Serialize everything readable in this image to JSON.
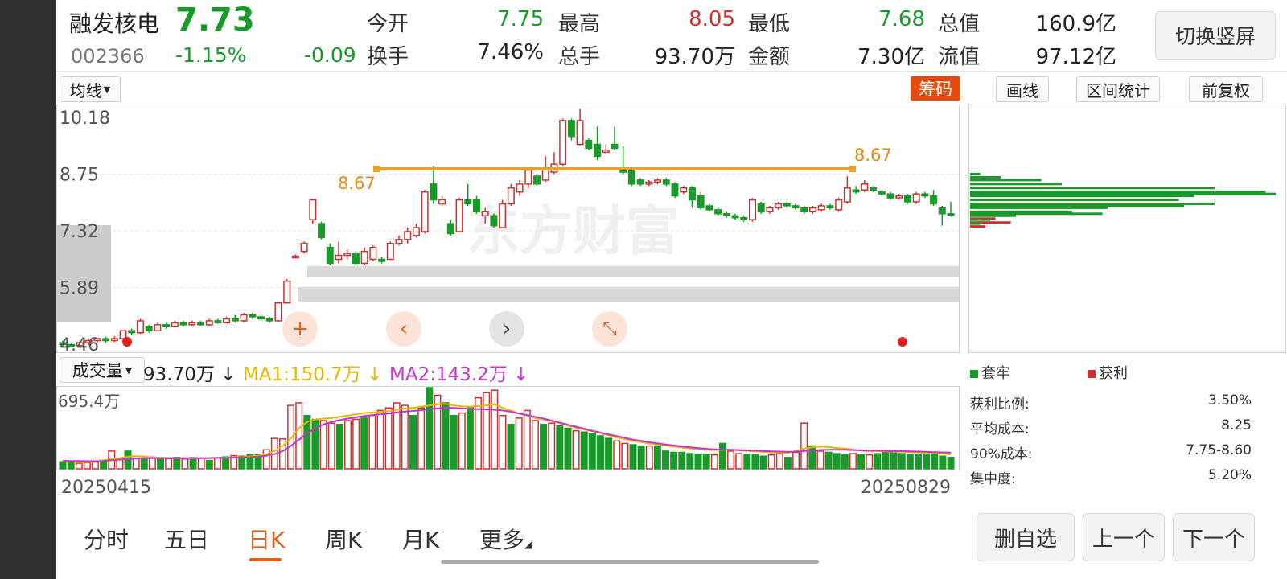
{
  "stock": {
    "name": "融发核电",
    "price": "7.73",
    "code": "002366",
    "change_pct": "-1.15%",
    "change": "-0.09"
  },
  "quote": {
    "open_label": "今开",
    "open": "7.75",
    "high_label": "最高",
    "high": "8.05",
    "low_label": "最低",
    "low": "7.68",
    "mktcap_label": "总值",
    "mktcap": "160.9亿",
    "turnover_label": "换手",
    "turnover": "7.46%",
    "vol_label": "总手",
    "vol": "93.70万",
    "amount_label": "金额",
    "amount": "7.30亿",
    "float_label": "流值",
    "float": "97.12亿"
  },
  "switch_button": "切换竖屏",
  "toolbar": {
    "ma_select": "均线",
    "chip_label": "筹码",
    "draw_label": "画线",
    "range_stats_label": "区间统计",
    "adjust_label": "前复权"
  },
  "price_axis": [
    "10.18",
    "8.75",
    "7.32",
    "5.89",
    "4.46"
  ],
  "cost_level_label": "8.67",
  "watermark": "东方财富",
  "volume": {
    "select_label": "成交量",
    "value": "93.70万",
    "ma1": "MA1:150.7万",
    "ma2": "MA2:143.2万",
    "axis_max": "695.4万"
  },
  "dates": {
    "start": "20250415",
    "end": "20250829"
  },
  "chip": {
    "legend_loss": "套牢",
    "legend_profit": "获利",
    "stats": [
      {
        "label": "获利比例:",
        "value": "3.50%"
      },
      {
        "label": "平均成本:",
        "value": "8.25"
      },
      {
        "label": "90%成本:",
        "value": "7.75-8.60"
      },
      {
        "label": "集中度:",
        "value": "5.20%"
      }
    ]
  },
  "tabs": [
    "分时",
    "五日",
    "日K",
    "周K",
    "月K",
    "更多"
  ],
  "active_tab": "日K",
  "bottom_buttons": {
    "remove": "删自选",
    "prev": "上一个",
    "next": "下一个"
  },
  "colors": {
    "up": "#d23030",
    "down": "#1a9a2a",
    "cost_line": "#f0a020",
    "ma1": "#e6b800",
    "ma2": "#cc33cc",
    "chip_button": "#e34b0e"
  },
  "chart_data": {
    "type": "candlestick",
    "y_axis": [
      4.46,
      10.18
    ],
    "candles": [
      [
        4.5,
        4.45,
        4.55,
        4.4
      ],
      [
        4.45,
        4.42,
        4.5,
        4.38
      ],
      [
        4.42,
        4.5,
        4.55,
        4.4
      ],
      [
        4.5,
        4.55,
        4.6,
        4.45
      ],
      [
        4.55,
        4.6,
        4.62,
        4.5
      ],
      [
        4.6,
        4.55,
        4.65,
        4.5
      ],
      [
        4.55,
        4.6,
        4.66,
        4.52
      ],
      [
        4.6,
        4.8,
        4.82,
        4.58
      ],
      [
        4.8,
        4.75,
        4.85,
        4.7
      ],
      [
        4.75,
        5.05,
        5.1,
        4.72
      ],
      [
        4.9,
        4.8,
        4.95,
        4.75
      ],
      [
        4.8,
        4.95,
        5,
        4.78
      ],
      [
        4.95,
        4.9,
        5,
        4.85
      ],
      [
        4.9,
        5,
        5.05,
        4.88
      ],
      [
        5,
        4.95,
        5.05,
        4.9
      ],
      [
        4.95,
        5,
        5.05,
        4.9
      ],
      [
        5,
        4.95,
        5.05,
        4.92
      ],
      [
        4.95,
        5.05,
        5.1,
        4.92
      ],
      [
        5.05,
        5,
        5.1,
        4.98
      ],
      [
        5,
        5.1,
        5.15,
        4.98
      ],
      [
        5.1,
        5.05,
        5.2,
        5
      ],
      [
        5.05,
        5.2,
        5.25,
        5.02
      ],
      [
        5.2,
        5.15,
        5.25,
        5.1
      ],
      [
        5.15,
        5.1,
        5.2,
        5.05
      ],
      [
        5.1,
        5.05,
        5.15,
        5
      ],
      [
        5.05,
        5.5,
        5.52,
        5.05
      ],
      [
        5.5,
        6.05,
        6.1,
        5.5
      ],
      [
        6.66,
        6.68,
        6.72,
        6.62
      ],
      [
        6.8,
        7.0,
        7.05,
        6.75
      ],
      [
        7.6,
        8.1,
        8.12,
        7.5
      ],
      [
        7.5,
        7.15,
        7.55,
        7.1
      ],
      [
        6.9,
        6.5,
        7.0,
        6.45
      ],
      [
        6.6,
        6.7,
        7.05,
        6.5
      ],
      [
        6.7,
        6.75,
        6.85,
        6.6
      ],
      [
        6.75,
        6.5,
        6.8,
        6.4
      ],
      [
        6.5,
        6.8,
        6.9,
        6.45
      ],
      [
        6.6,
        6.9,
        6.95,
        6.55
      ],
      [
        6.6,
        6.55,
        6.65,
        6.5
      ],
      [
        6.6,
        7.0,
        7.05,
        6.58
      ],
      [
        7.0,
        7.1,
        7.2,
        6.95
      ],
      [
        7.1,
        7.3,
        7.4,
        7.0
      ],
      [
        7.2,
        7.4,
        7.5,
        7.15
      ],
      [
        7.3,
        8.3,
        8.35,
        7.25
      ],
      [
        8.5,
        8.1,
        8.95,
        8.0
      ],
      [
        8.0,
        8.1,
        8.2,
        7.95
      ],
      [
        7.5,
        7.25,
        7.6,
        7.2
      ],
      [
        7.3,
        8.1,
        8.15,
        7.28
      ],
      [
        8.1,
        8.0,
        8.5,
        7.95
      ],
      [
        8.1,
        7.8,
        8.2,
        7.75
      ],
      [
        7.7,
        7.8,
        7.9,
        7.5
      ],
      [
        7.7,
        7.45,
        7.75,
        7.4
      ],
      [
        7.4,
        8.0,
        8.1,
        7.38
      ],
      [
        8.0,
        8.4,
        8.5,
        7.95
      ],
      [
        8.3,
        8.5,
        8.6,
        8.2
      ],
      [
        8.5,
        8.85,
        8.9,
        8.4
      ],
      [
        8.7,
        8.5,
        8.75,
        8.45
      ],
      [
        8.6,
        8.9,
        9.2,
        8.55
      ],
      [
        8.8,
        9.0,
        9.3,
        8.75
      ],
      [
        9.0,
        10.1,
        10.15,
        8.95
      ],
      [
        10.1,
        9.7,
        10.15,
        9.6
      ],
      [
        9.5,
        10.1,
        10.4,
        9.45
      ],
      [
        9.6,
        9.4,
        9.65,
        9.35
      ],
      [
        9.5,
        9.2,
        9.95,
        9.1
      ],
      [
        9.3,
        9.35,
        9.5,
        9.25
      ],
      [
        9.5,
        9.4,
        9.95,
        9.35
      ],
      [
        8.9,
        8.8,
        9.45,
        8.75
      ],
      [
        8.85,
        8.5,
        8.9,
        8.45
      ],
      [
        8.6,
        8.5,
        8.65,
        8.45
      ],
      [
        8.5,
        8.55,
        8.6,
        8.45
      ],
      [
        8.55,
        8.6,
        8.65,
        8.5
      ],
      [
        8.6,
        8.5,
        8.65,
        8.45
      ],
      [
        8.5,
        8.2,
        8.55,
        8.15
      ],
      [
        8.3,
        8.4,
        8.45,
        8.25
      ],
      [
        8.4,
        8.1,
        8.45,
        7.9
      ],
      [
        8.2,
        7.9,
        8.3,
        7.85
      ],
      [
        7.95,
        7.85,
        8.0,
        7.8
      ],
      [
        7.85,
        7.75,
        7.9,
        7.7
      ],
      [
        7.75,
        7.7,
        7.8,
        7.65
      ],
      [
        7.7,
        7.65,
        7.75,
        7.6
      ],
      [
        7.65,
        7.6,
        7.7,
        7.55
      ],
      [
        7.6,
        8.1,
        8.15,
        7.55
      ],
      [
        8.0,
        7.8,
        8.05,
        7.75
      ],
      [
        7.8,
        7.9,
        7.95,
        7.75
      ],
      [
        7.9,
        8.0,
        8.05,
        7.85
      ],
      [
        8.0,
        7.95,
        8.05,
        7.9
      ],
      [
        7.95,
        7.9,
        8.0,
        7.85
      ],
      [
        7.9,
        7.8,
        7.95,
        7.75
      ],
      [
        7.8,
        7.9,
        7.95,
        7.75
      ],
      [
        7.85,
        7.95,
        8.0,
        7.8
      ],
      [
        7.95,
        7.9,
        8.0,
        7.85
      ],
      [
        7.85,
        8.1,
        8.15,
        7.8
      ],
      [
        8.05,
        8.4,
        8.7,
        8.0
      ],
      [
        8.35,
        8.3,
        8.45,
        8.25
      ],
      [
        8.35,
        8.5,
        8.6,
        8.3
      ],
      [
        8.4,
        8.35,
        8.45,
        8.3
      ],
      [
        8.3,
        8.25,
        8.35,
        8.2
      ],
      [
        8.25,
        8.15,
        8.3,
        8.1
      ],
      [
        8.15,
        8.2,
        8.25,
        8.1
      ],
      [
        8.2,
        8.05,
        8.25,
        8.0
      ],
      [
        8.05,
        8.25,
        8.3,
        8.0
      ],
      [
        8.25,
        8.2,
        8.3,
        8.15
      ],
      [
        8.2,
        8.0,
        8.35,
        7.95
      ],
      [
        7.9,
        7.75,
        7.95,
        7.45
      ],
      [
        7.75,
        7.73,
        8.05,
        7.68
      ]
    ],
    "volume": [
      28,
      26,
      22,
      25,
      27,
      34,
      70,
      38,
      70,
      41,
      43,
      46,
      37,
      40,
      45,
      39,
      44,
      43,
      33,
      44,
      47,
      52,
      50,
      57,
      55,
      75,
      120,
      118,
      250,
      260,
      210,
      195,
      190,
      180,
      175,
      190,
      195,
      200,
      210,
      230,
      240,
      260,
      250,
      210,
      240,
      320,
      290,
      260,
      210,
      220,
      240,
      280,
      300,
      310,
      210,
      175,
      200,
      230,
      190,
      175,
      180,
      170,
      160,
      150,
      145,
      140,
      130,
      120,
      110,
      100,
      95,
      90,
      90,
      90,
      70,
      65,
      65,
      60,
      58,
      55,
      55,
      100,
      70,
      60,
      58,
      55,
      50,
      55,
      60,
      45,
      65,
      180,
      90,
      70,
      65,
      60,
      55,
      60,
      55,
      55,
      60,
      70,
      70,
      60,
      55,
      55,
      60,
      65,
      50,
      45
    ],
    "ma1": [
      30,
      30,
      29,
      28,
      29,
      33,
      40,
      42,
      48,
      50,
      49,
      44,
      44,
      43,
      42,
      42,
      41,
      42,
      43,
      44,
      44,
      45,
      46,
      49,
      52,
      58,
      70,
      90,
      120,
      160,
      185,
      195,
      198,
      200,
      205,
      210,
      215,
      220,
      222,
      225,
      228,
      233,
      238,
      240,
      245,
      250,
      255,
      256,
      250,
      246,
      245,
      248,
      250,
      255,
      240,
      230,
      218,
      210,
      200,
      195,
      188,
      180,
      170,
      162,
      155,
      148,
      140,
      132,
      124,
      117,
      110,
      105,
      100,
      96,
      92,
      88,
      84,
      80,
      78,
      75,
      74,
      75,
      75,
      73,
      71,
      69,
      67,
      65,
      64,
      63,
      70,
      80,
      85,
      88,
      86,
      82,
      80,
      76,
      72,
      70,
      70,
      69,
      68,
      67,
      66,
      65,
      63,
      62,
      60,
      58
    ],
    "ma2": [
      32,
      31,
      31,
      30,
      30,
      31,
      34,
      36,
      39,
      41,
      42,
      42,
      42,
      42,
      42,
      42,
      42,
      42,
      42,
      43,
      43,
      44,
      45,
      46,
      48,
      52,
      58,
      70,
      90,
      115,
      140,
      160,
      175,
      185,
      192,
      198,
      203,
      208,
      212,
      215,
      218,
      222,
      226,
      228,
      231,
      235,
      238,
      240,
      240,
      238,
      236,
      235,
      234,
      233,
      230,
      225,
      218,
      212,
      205,
      198,
      190,
      182,
      174,
      166,
      158,
      150,
      143,
      136,
      129,
      122,
      115,
      110,
      105,
      100,
      96,
      92,
      88,
      85,
      82,
      79,
      77,
      76,
      75,
      74,
      73,
      72,
      70,
      69,
      68,
      67,
      68,
      70,
      72,
      74,
      75,
      75,
      75,
      74,
      73,
      72,
      72,
      71,
      70,
      70,
      69,
      68,
      67,
      66,
      65,
      64
    ],
    "cost_line": 8.67,
    "chip_distribution": {
      "levels": [
        "8.75",
        "8.67",
        "8.6",
        "8.5",
        "8.4",
        "8.3",
        "8.25",
        "8.2",
        "8.1",
        "8.0",
        "7.95",
        "7.9",
        "7.8",
        "7.75",
        "7.7",
        "7.6",
        "7.5"
      ],
      "loss": [
        2,
        6,
        14,
        18,
        48,
        58,
        60,
        44,
        41,
        48,
        42,
        27,
        20,
        26,
        9,
        4,
        2
      ],
      "profit": [
        0,
        0,
        0,
        0,
        0,
        0,
        0,
        0,
        0,
        0,
        0,
        0,
        0,
        0,
        5,
        8,
        3
      ]
    }
  }
}
